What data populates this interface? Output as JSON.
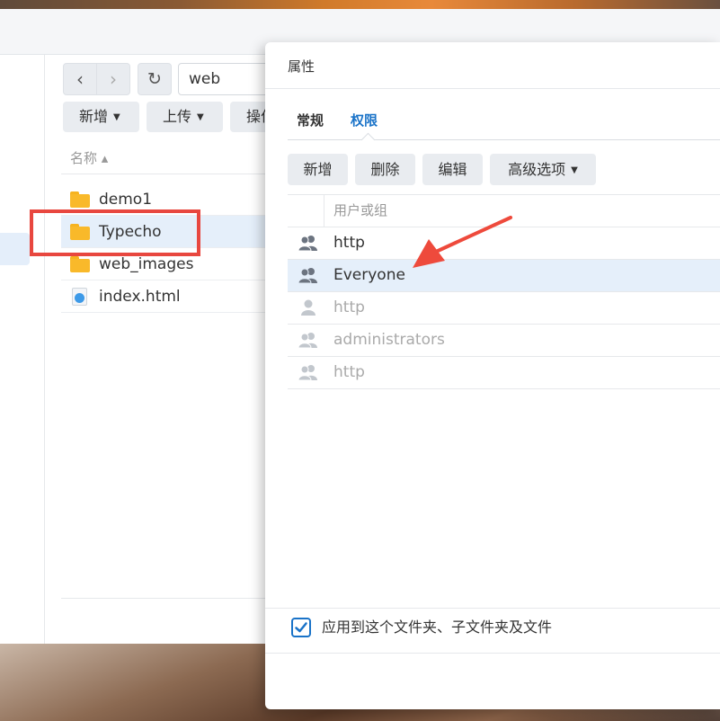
{
  "file_station": {
    "path": "web",
    "toolbar": {
      "new_label": "新增",
      "upload_label": "上传",
      "action_label": "操作"
    },
    "list_header": "名称 ▴",
    "files": [
      {
        "name": "demo1",
        "type": "folder"
      },
      {
        "name": "Typecho",
        "type": "folder",
        "selected": true
      },
      {
        "name": "web_images",
        "type": "folder"
      },
      {
        "name": "index.html",
        "type": "html-file"
      }
    ]
  },
  "properties_dialog": {
    "title": "属性",
    "tabs": [
      {
        "label": "常规",
        "active": false
      },
      {
        "label": "权限",
        "active": true
      }
    ],
    "buttons": {
      "add_label": "新增",
      "delete_label": "删除",
      "edit_label": "编辑",
      "advanced_label": "高级选项"
    },
    "table_header": "用户或组",
    "rows": [
      {
        "name": "http",
        "icon": "user-group-icon",
        "inherited": false
      },
      {
        "name": "Everyone",
        "icon": "user-group-icon",
        "inherited": false,
        "selected": true
      },
      {
        "name": "http",
        "icon": "user-icon",
        "inherited": true
      },
      {
        "name": "administrators",
        "icon": "user-group-icon",
        "inherited": true
      },
      {
        "name": "http",
        "icon": "user-group-icon",
        "inherited": true
      }
    ],
    "apply_checkbox": {
      "label": "应用到这个文件夹、子文件夹及文件",
      "checked": true
    }
  },
  "colors": {
    "accent": "#1a73c8",
    "highlight_box": "#e8473f",
    "folder": "#f9b92a",
    "selection": "#e5effa"
  }
}
